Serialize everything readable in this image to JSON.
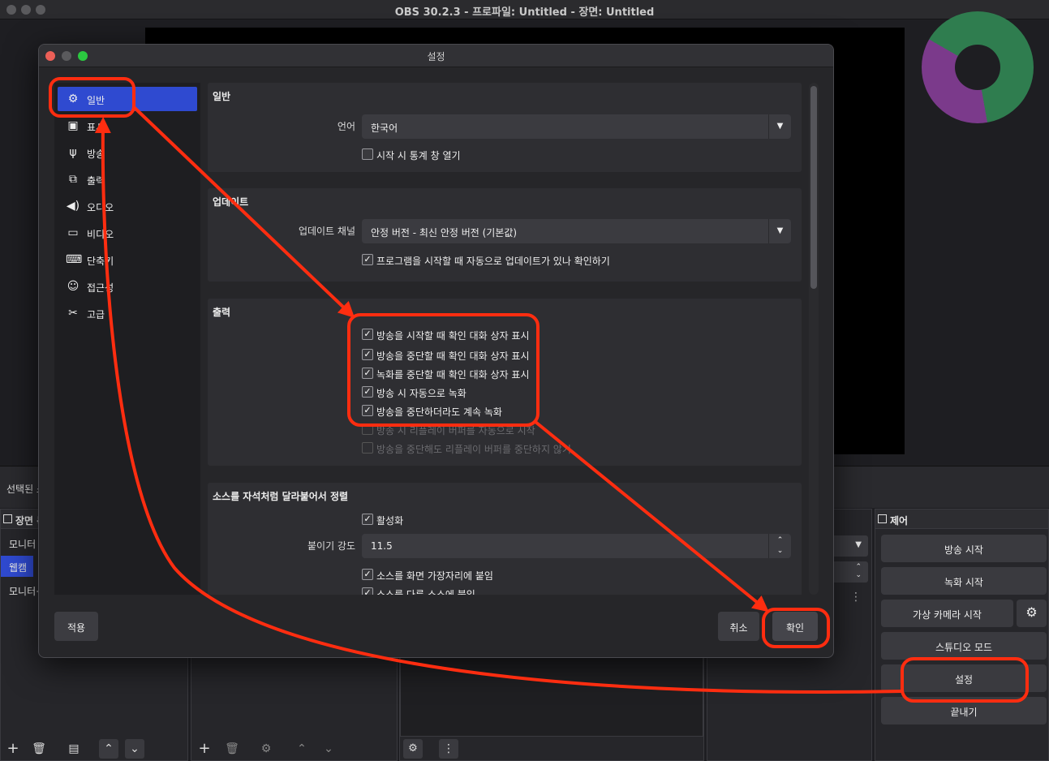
{
  "window": {
    "title": "OBS 30.2.3 - 프로파일: Untitled - 장면: Untitled"
  },
  "selection_bar": {
    "text": "선택된 소"
  },
  "scenes": {
    "header": "장면 목",
    "items": [
      "모니터",
      "웹캠",
      "모니터+"
    ]
  },
  "controls": {
    "header": "제어",
    "buttons": [
      "방송 시작",
      "녹화 시작",
      "가상 카메라 시작",
      "스튜디오 모드",
      "설정",
      "끝내기"
    ]
  },
  "dialog": {
    "title": "설정",
    "sidebar": [
      {
        "label": "일반",
        "icon": "gear-icon"
      },
      {
        "label": "표시",
        "icon": "display-icon"
      },
      {
        "label": "방송",
        "icon": "antenna-icon"
      },
      {
        "label": "출력",
        "icon": "output-icon"
      },
      {
        "label": "오디오",
        "icon": "speaker-icon"
      },
      {
        "label": "비디오",
        "icon": "monitor-icon"
      },
      {
        "label": "단축키",
        "icon": "keyboard-icon"
      },
      {
        "label": "접근성",
        "icon": "accessibility-icon"
      },
      {
        "label": "고급",
        "icon": "tools-icon"
      }
    ],
    "general": {
      "heading": "일반",
      "language_label": "언어",
      "language_value": "한국어",
      "stats_checkbox": "시작 시 통계 창 열기"
    },
    "update": {
      "heading": "업데이트",
      "channel_label": "업데이트 채널",
      "channel_value": "안정 버전 - 최신 안정 버전 (기본값)",
      "auto_check": "프로그램을 시작할 때 자동으로 업데이트가 있나 확인하기"
    },
    "output": {
      "heading": "출력",
      "checks": [
        {
          "label": "방송을 시작할 때 확인 대화 상자 표시",
          "checked": true,
          "disabled": false
        },
        {
          "label": "방송을 중단할 때 확인 대화 상자 표시",
          "checked": true,
          "disabled": false
        },
        {
          "label": "녹화를 중단할 때 확인 대화 상자 표시",
          "checked": true,
          "disabled": false
        },
        {
          "label": "방송 시 자동으로 녹화",
          "checked": true,
          "disabled": false
        },
        {
          "label": "방송을 중단하더라도 계속 녹화",
          "checked": true,
          "disabled": false
        },
        {
          "label": "방송 시 리플레이 버퍼를 자동으로 시작",
          "checked": false,
          "disabled": true
        },
        {
          "label": "방송을 중단해도 리플레이 버퍼를 중단하지 않기",
          "checked": false,
          "disabled": true
        }
      ]
    },
    "snapping": {
      "heading": "소스를 자석처럼 달라붙어서 정렬",
      "enable": "활성화",
      "strength_label": "붙이기 강도",
      "strength_value": "11.5",
      "snap_edges": "소스를 화면 가장자리에 붙임",
      "snap_other": "소스를 다른 소스에 붙임"
    },
    "buttons": {
      "apply": "적용",
      "cancel": "취소",
      "ok": "확인"
    }
  }
}
